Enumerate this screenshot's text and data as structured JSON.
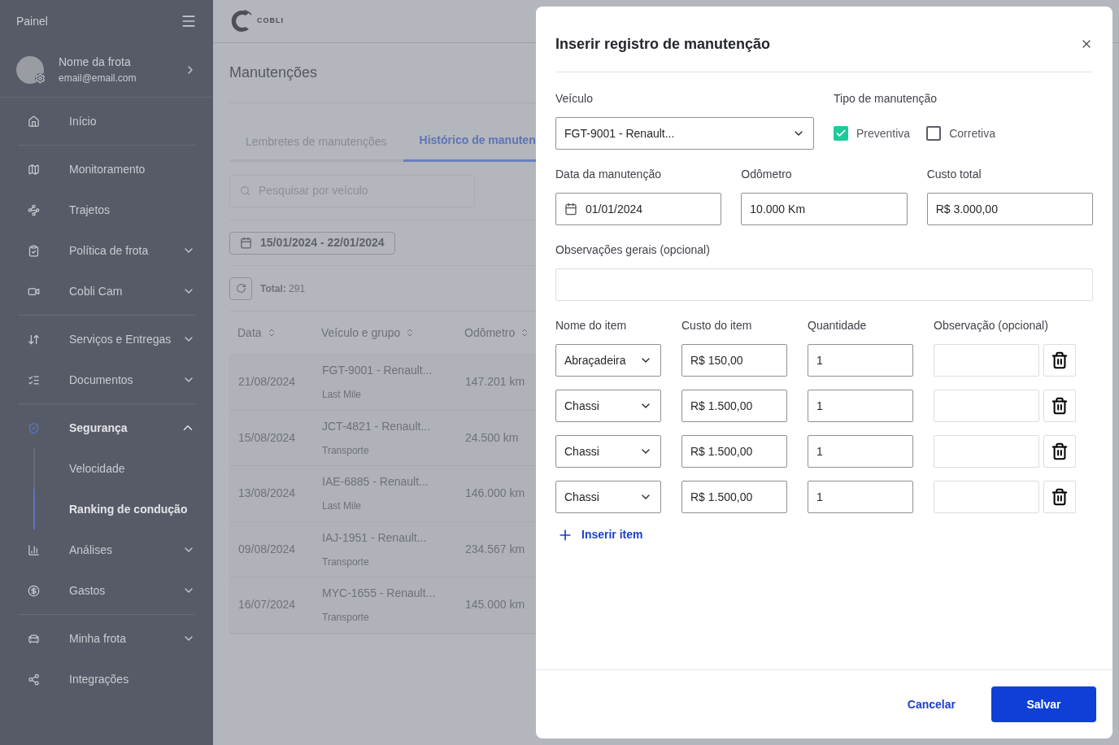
{
  "sidebar": {
    "title": "Painel",
    "profile": {
      "name": "Nome da frota",
      "email": "email@email.com"
    },
    "groups": [
      [
        {
          "label": "Início"
        }
      ],
      [
        {
          "label": "Monitoramento"
        },
        {
          "label": "Trajetos"
        },
        {
          "label": "Política de frota",
          "expanded": false
        },
        {
          "label": "Cobli Cam",
          "expanded": false
        }
      ],
      [
        {
          "label": "Serviços e Entregas",
          "expanded": false
        },
        {
          "label": "Documentos",
          "expanded": false
        }
      ],
      [
        {
          "label": "Segurança",
          "expanded": true,
          "children": [
            {
              "label": "Velocidade",
              "selected": false
            },
            {
              "label": "Ranking de condução",
              "selected": true
            }
          ]
        },
        {
          "label": "Análises",
          "expanded": false
        },
        {
          "label": "Gastos",
          "expanded": false
        }
      ],
      [
        {
          "label": "Minha frota",
          "expanded": false
        },
        {
          "label": "Integrações"
        }
      ]
    ]
  },
  "header": {
    "logo_text": "COBLI"
  },
  "page": {
    "title": "Manutenções",
    "tabs": [
      {
        "label": "Lembretes de manutenções",
        "selected": false
      },
      {
        "label": "Histórico de manuten",
        "selected": true
      }
    ],
    "search": {
      "placeholder": "Pesquisar por veículo"
    },
    "date_range": "15/01/2024 - 22/01/2024",
    "total": "**Total:** 291",
    "table": {
      "columns": [
        "Data",
        "Veículo e grupo",
        "Odômetro"
      ],
      "rows": [
        {
          "date": "21/08/2024",
          "vehicle": "FGT-9001 - Renault...",
          "group": "Last Mile",
          "odometer": "147.201 km"
        },
        {
          "date": "15/08/2024",
          "vehicle": "JCT-4821 - Renault...",
          "group": "Transporte",
          "odometer": "24.500 km"
        },
        {
          "date": "13/08/2024",
          "vehicle": "IAE-6885 - Renault...",
          "group": "Last Mile",
          "odometer": "146.000 km"
        },
        {
          "date": "09/08/2024",
          "vehicle": "IAJ-1951 - Renault...",
          "group": "Transporte",
          "odometer": "234.567 km"
        },
        {
          "date": "16/07/2024",
          "vehicle": "MYC-1655 - Renault...",
          "group": "Transporte",
          "odometer": "145.000 km"
        }
      ]
    }
  },
  "modal": {
    "title": "Inserir registro de manutenção",
    "vehicle": {
      "label": "Veículo",
      "value": "FGT-9001 - Renault..."
    },
    "type": {
      "label": "Tipo de manutenção",
      "options": [
        {
          "label": "Preventiva",
          "checked": true
        },
        {
          "label": "Corretiva",
          "checked": false
        }
      ]
    },
    "date": {
      "label": "Data da manutenção",
      "value": "01/01/2024"
    },
    "odometer": {
      "label": "Odômetro",
      "value": "10.000 Km"
    },
    "total_cost": {
      "label": "Custo total",
      "value": "R$ 3.000,00"
    },
    "notes": {
      "label": "Observações gerais (opcional)"
    },
    "items": {
      "columns": [
        "Nome do item",
        "Custo do item",
        "Quantidade",
        "Observação (opcional)"
      ],
      "rows": [
        {
          "item": "Abraçadeira",
          "cost": "R$ 150,00",
          "quantity": "1"
        },
        {
          "item": "Chassi",
          "cost": "R$ 1.500,00",
          "quantity": "1"
        },
        {
          "item": "Chassi",
          "cost": "R$ 1.500,00",
          "quantity": "1"
        },
        {
          "item": "Chassi",
          "cost": "R$ 1.500,00",
          "quantity": "1"
        }
      ]
    },
    "add_item": "Inserir item",
    "buttons": {
      "cancel": "Cancelar",
      "save": "Salvar"
    }
  }
}
